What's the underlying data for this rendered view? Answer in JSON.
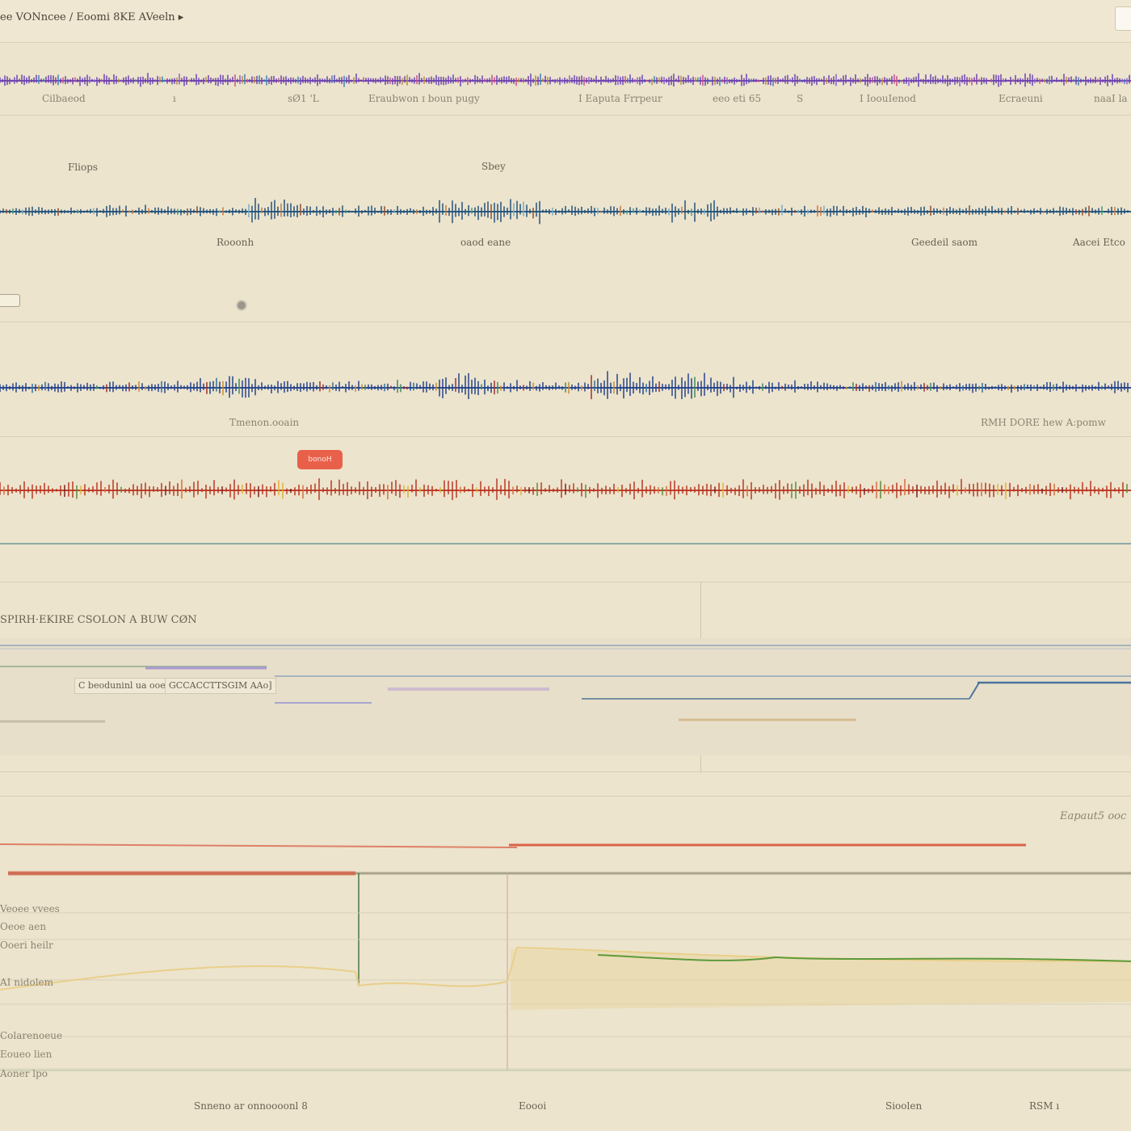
{
  "window": {
    "title": "ee VONncee / Eoomi 8KE AVeeln ▸"
  },
  "tracks": {
    "track1": {
      "color": "#6b3fb0",
      "labels": [
        "Cilbaeod",
        "ı",
        "sØ1 'L",
        "Eraubwon ɪ boun pugy",
        "I Eaputa Frrpeur",
        "eeo  eti 65",
        "S",
        "I IoouIenod",
        "Ecraeuni",
        "naaI la"
      ]
    },
    "track2": {
      "color": "#1e4f7a",
      "labels": [
        "Fliops",
        "Sbey",
        "Rooonh",
        "oaod eane",
        "Geedeil saom",
        "Aacei Etco"
      ]
    },
    "track3": {
      "color": "#1f3f8a",
      "labels": [
        "Tmenon.ooain",
        "RMH DORE hew A:pomw"
      ]
    },
    "track4": {
      "color": "#b8331f",
      "badge": "bonoH"
    }
  },
  "panel": {
    "header": "SPIRH·EKIRE CSOLON A BUW CØN",
    "fields": [
      "C beoduninl ua ooe",
      "GCCACCTTSGIM AAo]"
    ]
  },
  "lower_chart": {
    "corner_label": "Eapaut5 ooc",
    "row_labels": [
      "Veoee vvees",
      "Oeoe aen",
      "Ooeri heilr",
      "AI nidolem",
      "Colarenoeue",
      "Eoueo lien",
      "Aoner lpo"
    ],
    "line_colors": {
      "red": "#d9573c",
      "green": "#5e9a3a",
      "yellow": "#e9cf8a"
    }
  },
  "footer": {
    "labels": [
      "Snneno ar onnoooonl 8",
      "Eoooi",
      "Sioolen",
      "RSM ı"
    ]
  }
}
